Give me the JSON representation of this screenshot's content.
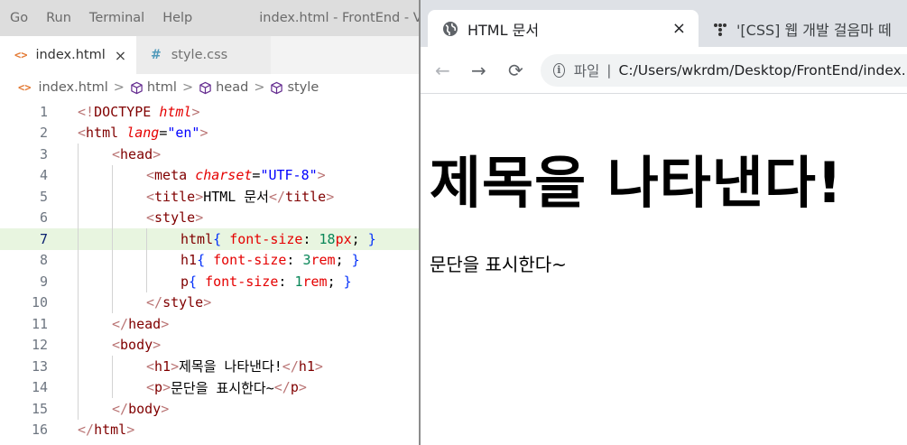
{
  "vscode": {
    "menu": [
      "Go",
      "Run",
      "Terminal",
      "Help"
    ],
    "window_title": "index.html - FrontEnd - Visu",
    "tabs": [
      {
        "icon": "<>",
        "label": "index.html",
        "close": "×"
      },
      {
        "icon": "#",
        "label": "style.css"
      }
    ],
    "breadcrumb": {
      "file_icon": "<>",
      "file": "index.html",
      "items": [
        "html",
        "head",
        "style"
      ],
      "sep": ">"
    },
    "line_numbers": [
      "1",
      "2",
      "3",
      "4",
      "5",
      "6",
      "7",
      "8",
      "9",
      "10",
      "11",
      "12",
      "13",
      "14",
      "15",
      "16"
    ],
    "code": {
      "l1": [
        "<!",
        "DOCTYPE",
        " ",
        "html",
        ">"
      ],
      "l2": [
        "<",
        "html",
        " ",
        "lang",
        "=",
        "\"en\"",
        ">"
      ],
      "l3": [
        "<",
        "head",
        ">"
      ],
      "l4": [
        "<",
        "meta",
        " ",
        "charset",
        "=",
        "\"UTF-8\"",
        ">"
      ],
      "l5": [
        "<",
        "title",
        ">",
        "HTML 문서",
        "</",
        "title",
        ">"
      ],
      "l6": [
        "<",
        "style",
        ">"
      ],
      "l7": [
        "html",
        "{",
        " ",
        "font-size",
        ": ",
        "18",
        "px",
        "; ",
        "}"
      ],
      "l8": [
        "h1",
        "{",
        " ",
        "font-size",
        ": ",
        "3",
        "rem",
        "; ",
        "}"
      ],
      "l9": [
        "p",
        "{",
        " ",
        "font-size",
        ": ",
        "1",
        "rem",
        "; ",
        "}"
      ],
      "l10": [
        "</",
        "style",
        ">"
      ],
      "l11": [
        "</",
        "head",
        ">"
      ],
      "l12": [
        "<",
        "body",
        ">"
      ],
      "l13": [
        "<",
        "h1",
        ">",
        "제목을 나타낸다!",
        "</",
        "h1",
        ">"
      ],
      "l14": [
        "<",
        "p",
        ">",
        "문단을 표시한다~",
        "</",
        "p",
        ">"
      ],
      "l15": [
        "</",
        "body",
        ">"
      ],
      "l16": [
        "</",
        "html",
        ">"
      ]
    }
  },
  "browser": {
    "tabs": [
      {
        "label": "HTML 문서",
        "close": "×"
      },
      {
        "label": "'[CSS] 웹 개발 걸음마 떼"
      }
    ],
    "nav": {
      "back": "←",
      "forward": "→",
      "reload": "⟳"
    },
    "omnibox": {
      "info": "i",
      "scheme": "파일",
      "bar": "|",
      "url": "C:/Users/wkrdm/Desktop/FrontEnd/index.html"
    },
    "page": {
      "h1": "제목을 나타낸다!",
      "p": "문단을 표시한다~"
    }
  },
  "colors": {
    "highlight_line": "#e8f5e0",
    "tag": "#800000",
    "attr": "#e50000",
    "string": "#0000ff",
    "number": "#098658"
  }
}
